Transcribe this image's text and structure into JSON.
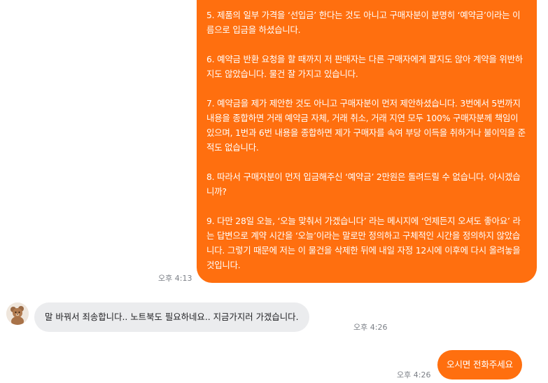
{
  "messages": {
    "outgoing_long": {
      "paragraphs": [
        "5. 제품의 일부 가격을 ‘선입금’ 한다는 것도 아니고 구매자분이 분명히 ‘예약금’이라는 이름으로 입금을 하셨습니다.",
        "6. 예약금 반환 요청을 할 때까지 저 판매자는 다른 구매자에게 팔지도 않아 계약을 위반하지도 않았습니다. 물건 잘 가지고 있습니다.",
        "7. 예약금을 제가 제안한 것도 아니고 구매자분이 먼저 제안하셨습니다. 3번에서 5번까지 내용을 종합하면 거래 예약금 자체, 거래 취소, 거래 지연 모두 100% 구매자분께 책임이 있으며, 1번과 6번 내용을 종합하면 제가 구매자를 속여 부당 이득을 취하거나 불이익을 준 적도 없습니다.",
        "8. 따라서 구매자분이 먼저 입금해주신 ‘예약금’ 2만원은 돌려드릴 수 없습니다. 아시겠습니까?",
        "9. 다만 28일 오늘, ‘오늘 맞춰서 가겠습니다’ 라는 메시지에 ‘언제든지 오셔도 좋아요’ 라는 답변으로 계약 시간을 ‘오늘’이라는 말로만 정의하고 구체적인 시간을 정의하지 않았습니다. 그렇기 때문에 저는 이 물건을 삭제한 뒤에 내일 자정 12시에 이후에 다시 올려놓을 것입니다."
      ],
      "time": "오후 4:13"
    },
    "incoming": {
      "text": "말 바꿔서 죄송합니다.. 노트북도 필요하네요.. 지금가지러 가겠습니다.",
      "time": "오후 4:26"
    },
    "outgoing_short": {
      "text": "오시면 전화주세요",
      "time": "오후 4:26"
    }
  },
  "colors": {
    "outgoing_bubble": "#ff6f0f",
    "incoming_bubble": "#ebecee",
    "timestamp": "#7b7f86"
  },
  "icons": {
    "avatar": "teddy-bear-avatar"
  }
}
